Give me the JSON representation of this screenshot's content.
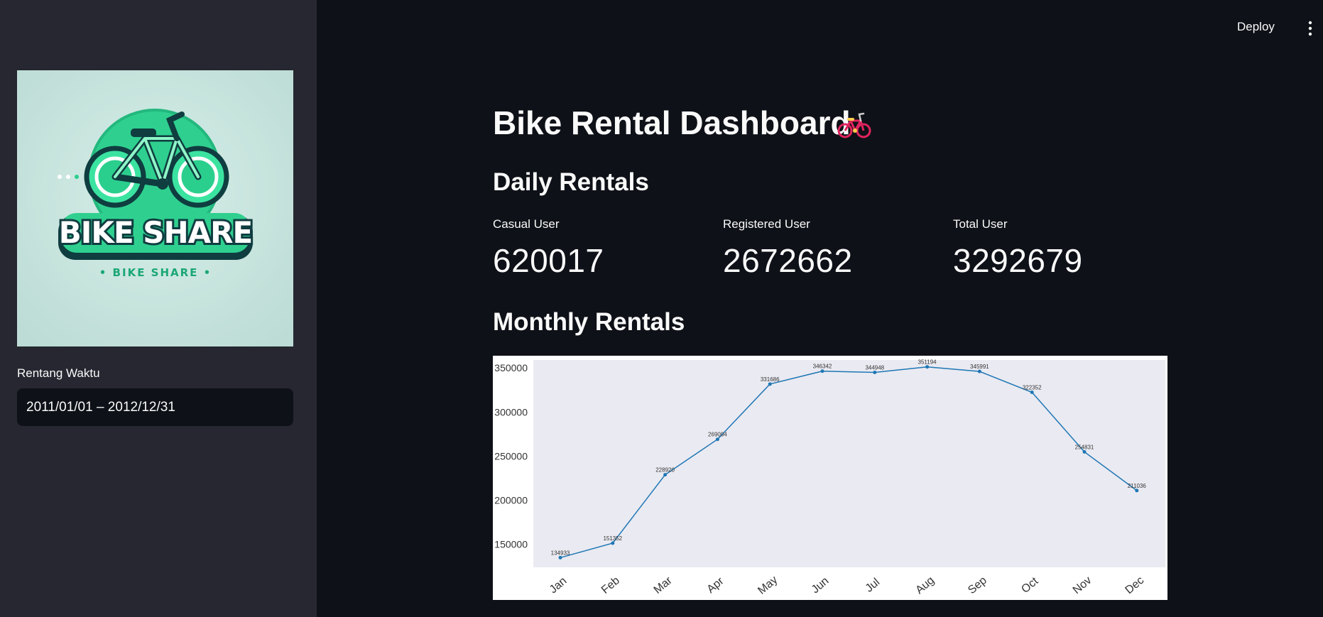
{
  "topbar": {
    "deploy_label": "Deploy",
    "menu_icon": "more-vertical-icon"
  },
  "sidebar": {
    "logo": {
      "icon": "bike-share-logo",
      "text_main": "BIKE SHARE",
      "text_sub": "• BIKE SHARE •"
    },
    "date_label": "Rentang Waktu",
    "date_value": "2011/01/01 – 2012/12/31"
  },
  "main": {
    "title": "Bike Rental Dashboard",
    "title_icon": "bicycle-icon",
    "daily_heading": "Daily Rentals",
    "metrics": [
      {
        "label": "Casual User",
        "value": "620017"
      },
      {
        "label": "Registered User",
        "value": "2672662"
      },
      {
        "label": "Total User",
        "value": "3292679"
      }
    ],
    "monthly_heading": "Monthly Rentals"
  },
  "colors": {
    "background": "#0e1117",
    "sidebar": "#262730",
    "plot_bg": "#eaeaf2",
    "line": "#1f77b4"
  },
  "chart_data": {
    "type": "line",
    "categories": [
      "Jan",
      "Feb",
      "Mar",
      "Apr",
      "May",
      "Jun",
      "Jul",
      "Aug",
      "Sep",
      "Oct",
      "Nov",
      "Dec"
    ],
    "values": [
      134933,
      151352,
      228920,
      269094,
      331686,
      346342,
      344948,
      351194,
      345991,
      322352,
      254831,
      211036
    ],
    "data_labels": [
      "134933",
      "151352",
      "228920",
      "269094",
      "331686",
      "346342",
      "344948",
      "351194",
      "345991",
      "322352",
      "254831",
      "211036"
    ],
    "yticks": [
      150000,
      200000,
      250000,
      300000,
      350000
    ],
    "ylim": [
      124000,
      359000
    ],
    "title": "",
    "xlabel": "",
    "ylabel": "",
    "grid": false
  }
}
